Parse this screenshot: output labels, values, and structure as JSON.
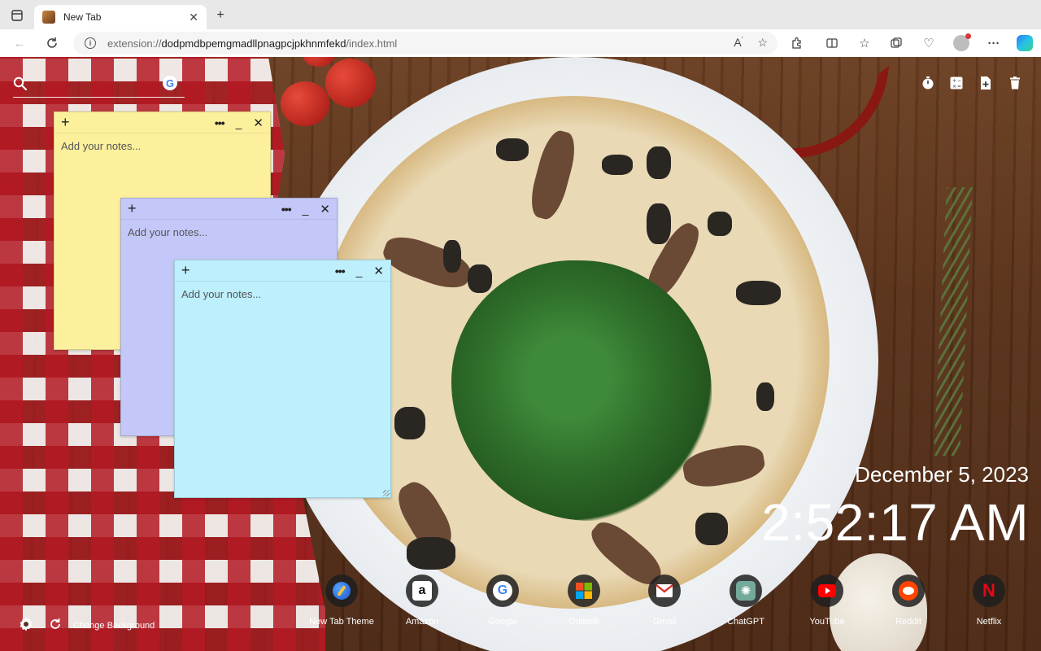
{
  "browser": {
    "tab_title": "New Tab",
    "url": {
      "scheme": "extension://",
      "host": "dodpmdbpemgmadllpnagpcjpkhnmfekd",
      "path": "/index.html"
    }
  },
  "search": {
    "placeholder": ""
  },
  "notes": [
    {
      "placeholder": "Add your notes...",
      "color": "#fdf09c"
    },
    {
      "placeholder": "Add your notes...",
      "color": "#c4c8f8"
    },
    {
      "placeholder": "Add your notes...",
      "color": "#bdeffc"
    }
  ],
  "clock": {
    "date": "December 5, 2023",
    "time": "2:52:17 AM"
  },
  "shortcuts": [
    {
      "label": "New Tab Theme",
      "icon": "new-tab-theme-icon"
    },
    {
      "label": "Amazon",
      "icon": "amazon-icon"
    },
    {
      "label": "Google",
      "icon": "google-icon"
    },
    {
      "label": "Outlook",
      "icon": "outlook-icon"
    },
    {
      "label": "Gmail",
      "icon": "gmail-icon"
    },
    {
      "label": "ChatGPT",
      "icon": "chatgpt-icon"
    },
    {
      "label": "YouTube",
      "icon": "youtube-icon"
    },
    {
      "label": "Reddit",
      "icon": "reddit-icon"
    },
    {
      "label": "Netflix",
      "icon": "netflix-icon"
    }
  ],
  "footer": {
    "change_background": "Change Background"
  }
}
